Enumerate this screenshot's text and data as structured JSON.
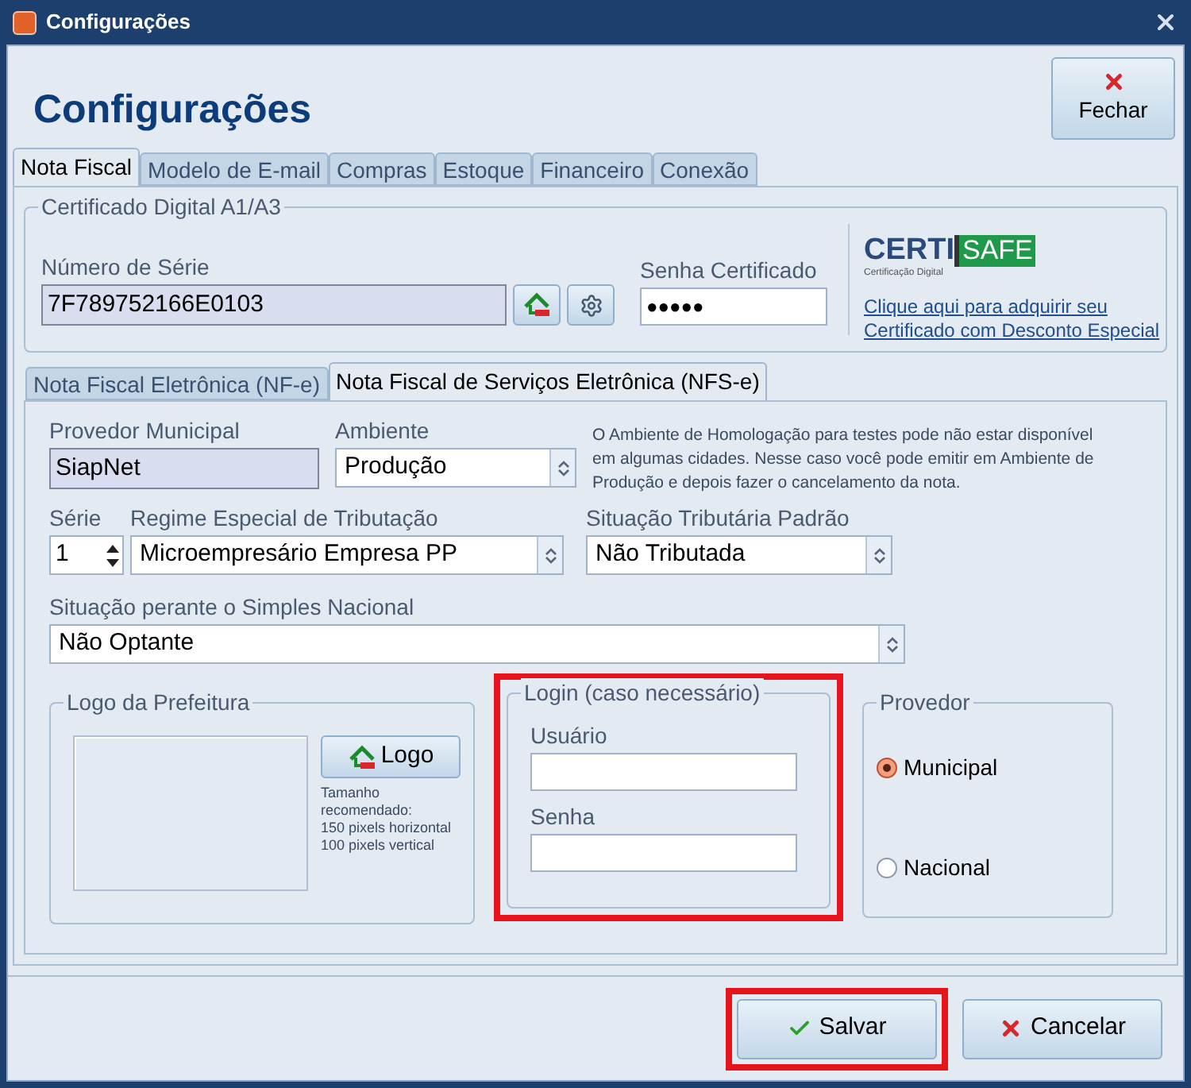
{
  "window": {
    "title": "Configurações"
  },
  "header": {
    "title": "Configurações",
    "close_button": "Fechar"
  },
  "tabs": [
    {
      "label": "Nota Fiscal",
      "selected": true
    },
    {
      "label": "Modelo de E-mail",
      "selected": false
    },
    {
      "label": "Compras",
      "selected": false
    },
    {
      "label": "Estoque",
      "selected": false
    },
    {
      "label": "Financeiro",
      "selected": false
    },
    {
      "label": "Conexão",
      "selected": false
    }
  ],
  "certificate": {
    "legend": "Certificado Digital A1/A3",
    "serial_label": "Número de Série",
    "serial_value": "7F789752166E0103",
    "password_label": "Senha Certificado",
    "password_value": "●●●●●",
    "logo": {
      "left": "CERTI",
      "right": "SAFE",
      "tagline": "Certificação Digital"
    },
    "link": "Clique aqui para adquirir seu Certificado com Desconto Especial"
  },
  "sub_tabs": [
    {
      "label": "Nota Fiscal Eletrônica (NF-e)",
      "selected": false
    },
    {
      "label": "Nota Fiscal de Serviços Eletrônica (NFS-e)",
      "selected": true
    }
  ],
  "nfse": {
    "provider_label": "Provedor Municipal",
    "provider_value": "SiapNet",
    "environment_label": "Ambiente",
    "environment_value": "Produção",
    "note": "O Ambiente de Homologação para testes pode não estar disponível em algumas cidades. Nesse caso você pode emitir em Ambiente de Produção e depois fazer o cancelamento da nota.",
    "series_label": "Série",
    "series_value": "1",
    "regime_label": "Regime Especial de Tributação",
    "regime_value": "Microempresário Empresa PP",
    "tax_label": "Situação Tributária Padrão",
    "tax_value": "Não Tributada",
    "simples_label": "Situação perante o Simples Nacional",
    "simples_value": "Não Optante",
    "logo_group": {
      "legend": "Logo da Prefeitura",
      "button": "Logo",
      "hint": "Tamanho\nrecomendado:\n150 pixels horizontal\n100 pixels vertical"
    },
    "login_group": {
      "legend": "Login (caso necessário)",
      "highlighted": true,
      "user_label": "Usuário",
      "password_label": "Senha"
    },
    "provider_group": {
      "legend": "Provedor",
      "options": [
        {
          "label": "Municipal",
          "selected": true
        },
        {
          "label": "Nacional",
          "selected": false
        }
      ]
    }
  },
  "buttons": [
    {
      "label": "Salvar",
      "kind": "save",
      "highlighted": true
    },
    {
      "label": "Cancelar",
      "kind": "cancel",
      "highlighted": false
    }
  ]
}
